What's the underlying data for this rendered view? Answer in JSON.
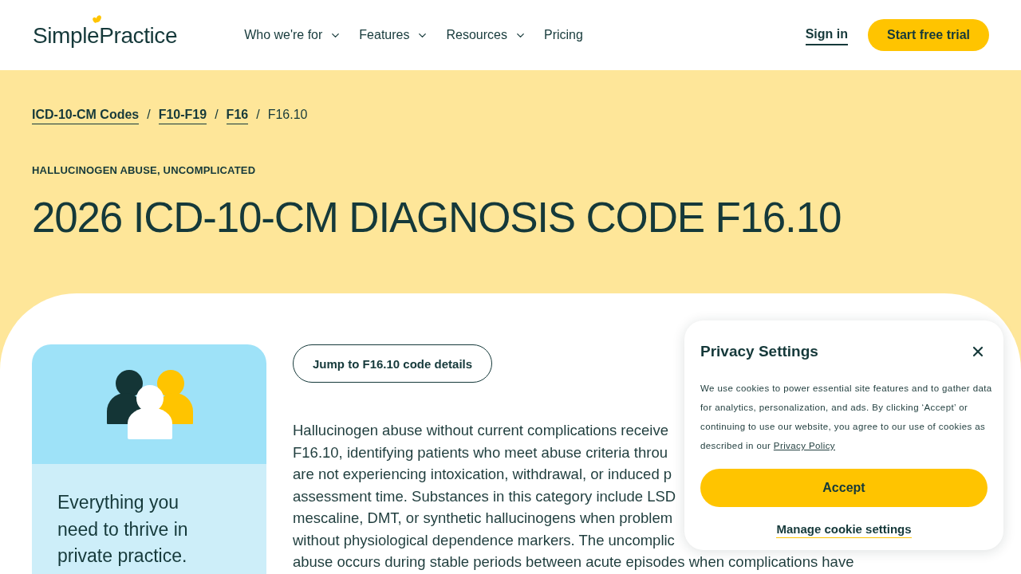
{
  "header": {
    "logo": "SimplePractice",
    "nav": [
      {
        "label": "Who we're for",
        "dropdown": true
      },
      {
        "label": "Features",
        "dropdown": true
      },
      {
        "label": "Resources",
        "dropdown": true
      },
      {
        "label": "Pricing",
        "dropdown": false
      }
    ],
    "sign_in": "Sign in",
    "cta": "Start free trial"
  },
  "breadcrumb": [
    {
      "kind": "link",
      "label": "ICD-10-CM Codes"
    },
    {
      "kind": "separator",
      "label": "/"
    },
    {
      "kind": "link",
      "label": "F10-F19"
    },
    {
      "kind": "separator",
      "label": "/"
    },
    {
      "kind": "link",
      "label": "F16"
    },
    {
      "kind": "separator",
      "label": "/"
    },
    {
      "kind": "current",
      "label": "F16.10"
    }
  ],
  "hero": {
    "eyebrow": "HALLUCINOGEN ABUSE, UNCOMPLICATED",
    "title": "2026 ICD-10-CM DIAGNOSIS CODE F16.10"
  },
  "promo_card": {
    "text": "Everything you need to thrive in private practice."
  },
  "jump_button": "Jump to F16.10 code details",
  "description_lines": [
    "Hallucinogen abuse without current complications receive",
    "F16.10, identifying patients who meet abuse criteria throu",
    "are not experiencing intoxication, withdrawal, or induced p",
    "assessment time. Substances in this category include LSD",
    "mescaline, DMT, or synthetic hallucinogens when problem",
    "without physiological dependence markers. The uncomplic",
    "abuse occurs during stable periods between acute episodes when complications have"
  ],
  "privacy_dialog": {
    "title": "Privacy Settings",
    "body": "We use cookies to power essential site features and to gather data for analytics, personalization, and ads. By clicking ‘Accept’ or\ncontinuing to use our website, you agree to our use of cookies as described in our",
    "link": "Privacy Policy",
    "accept": "Accept",
    "manage": "Manage cookie settings"
  }
}
